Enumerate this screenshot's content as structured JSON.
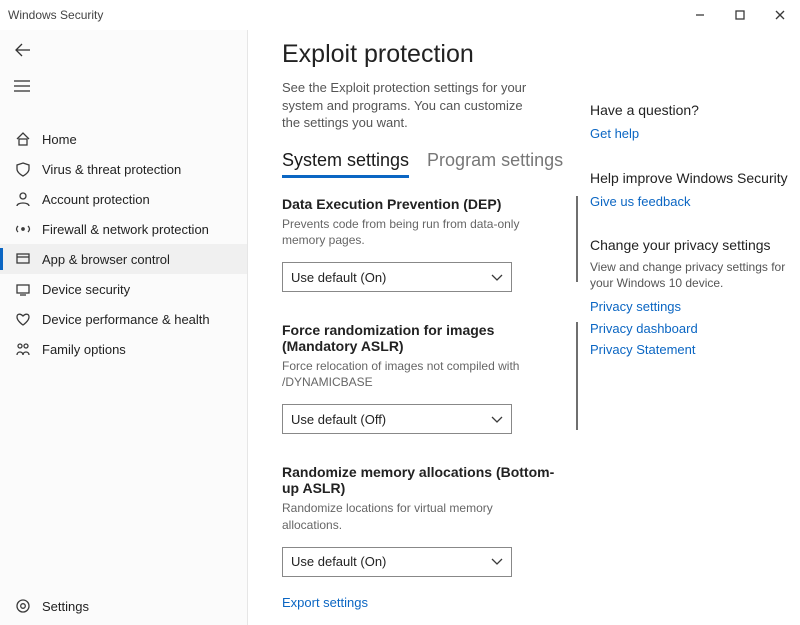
{
  "window": {
    "title": "Windows Security"
  },
  "sidebar": {
    "items": [
      {
        "label": "Home"
      },
      {
        "label": "Virus & threat protection"
      },
      {
        "label": "Account protection"
      },
      {
        "label": "Firewall & network protection"
      },
      {
        "label": "App & browser control"
      },
      {
        "label": "Device security"
      },
      {
        "label": "Device performance & health"
      },
      {
        "label": "Family options"
      }
    ],
    "settings_label": "Settings"
  },
  "main": {
    "heading": "Exploit protection",
    "subtitle": "See the Exploit protection settings for your system and programs.  You can customize the settings you want.",
    "tabs": [
      {
        "label": "System settings",
        "active": true
      },
      {
        "label": "Program settings",
        "active": false
      }
    ],
    "settings": [
      {
        "title": "Data Execution Prevention (DEP)",
        "desc": "Prevents code from being run from data-only memory pages.",
        "value": "Use default (On)",
        "accent": true
      },
      {
        "title": "Force randomization for images (Mandatory ASLR)",
        "desc": "Force relocation of images not compiled with /DYNAMICBASE",
        "value": "Use default (Off)",
        "accent": true
      },
      {
        "title": "Randomize memory allocations (Bottom-up ASLR)",
        "desc": "Randomize locations for virtual memory allocations.",
        "value": "Use default (On)",
        "accent": false
      }
    ],
    "export_label": "Export settings"
  },
  "aside": {
    "question": {
      "heading": "Have a question?",
      "link": "Get help"
    },
    "improve": {
      "heading": "Help improve Windows Security",
      "link": "Give us feedback"
    },
    "privacy": {
      "heading": "Change your privacy settings",
      "desc": "View and change privacy settings for your Windows 10 device.",
      "links": [
        "Privacy settings",
        "Privacy dashboard",
        "Privacy Statement"
      ]
    }
  }
}
